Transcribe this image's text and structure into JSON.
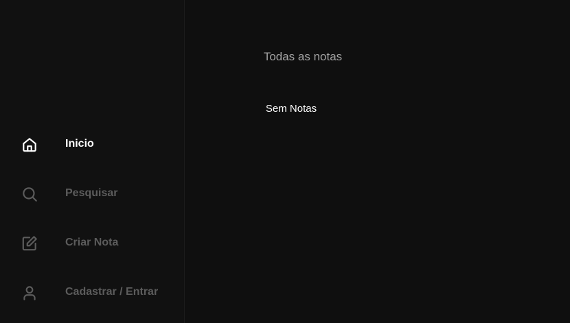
{
  "sidebar": {
    "items": [
      {
        "label": "Inicio",
        "icon": "home-icon",
        "active": true
      },
      {
        "label": "Pesquisar",
        "icon": "search-icon",
        "active": false
      },
      {
        "label": "Criar Nota",
        "icon": "edit-note-icon",
        "active": false
      },
      {
        "label": "Cadastrar / Entrar",
        "icon": "user-icon",
        "active": false
      }
    ]
  },
  "main": {
    "title": "Todas as notas",
    "empty_message": "Sem Notas"
  },
  "colors": {
    "background": "#0f0f0f",
    "sidebar_background": "#111111",
    "active_text": "#ffffff",
    "inactive_text": "#5c5c5c",
    "title_text": "#a3a3a3"
  }
}
